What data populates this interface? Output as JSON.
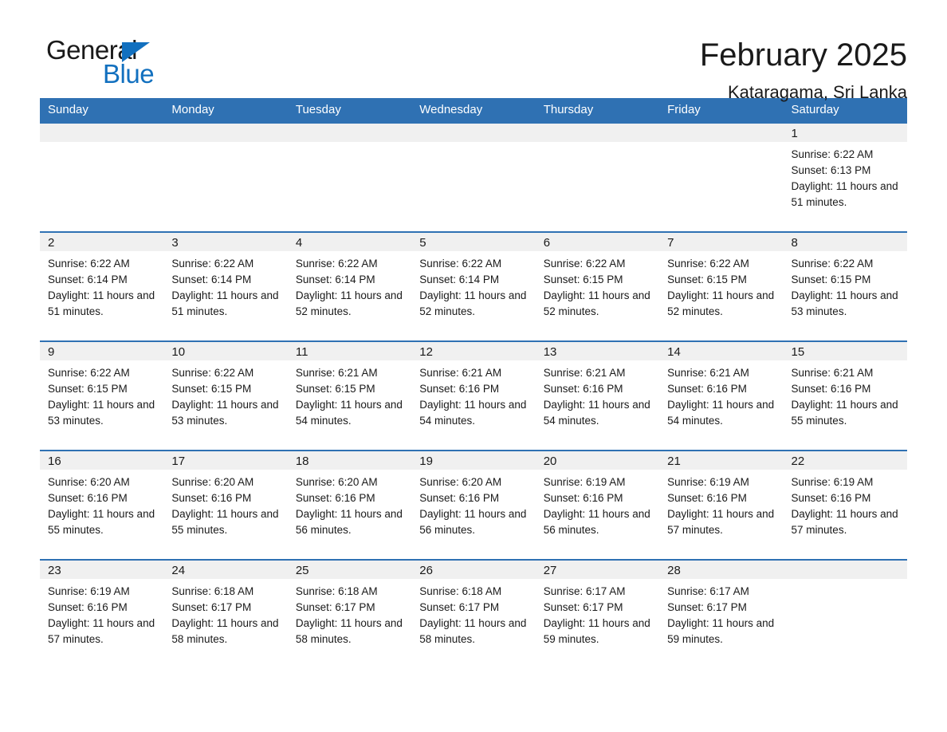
{
  "brand": {
    "name_part1": "General",
    "name_part2": "Blue",
    "triangle_color": "#1270bf"
  },
  "header": {
    "title": "February 2025",
    "subtitle": "Kataragama, Sri Lanka"
  },
  "theme": {
    "header_blue": "#2f71b3",
    "daynum_band": "#f0f0f0",
    "text": "#1a1a1a"
  },
  "calendar": {
    "weekdays": [
      "Sunday",
      "Monday",
      "Tuesday",
      "Wednesday",
      "Thursday",
      "Friday",
      "Saturday"
    ],
    "weeks": [
      [
        {
          "day": "",
          "sunrise": "",
          "sunset": "",
          "daylight": ""
        },
        {
          "day": "",
          "sunrise": "",
          "sunset": "",
          "daylight": ""
        },
        {
          "day": "",
          "sunrise": "",
          "sunset": "",
          "daylight": ""
        },
        {
          "day": "",
          "sunrise": "",
          "sunset": "",
          "daylight": ""
        },
        {
          "day": "",
          "sunrise": "",
          "sunset": "",
          "daylight": ""
        },
        {
          "day": "",
          "sunrise": "",
          "sunset": "",
          "daylight": ""
        },
        {
          "day": "1",
          "sunrise": "Sunrise: 6:22 AM",
          "sunset": "Sunset: 6:13 PM",
          "daylight": "Daylight: 11 hours and 51 minutes."
        }
      ],
      [
        {
          "day": "2",
          "sunrise": "Sunrise: 6:22 AM",
          "sunset": "Sunset: 6:14 PM",
          "daylight": "Daylight: 11 hours and 51 minutes."
        },
        {
          "day": "3",
          "sunrise": "Sunrise: 6:22 AM",
          "sunset": "Sunset: 6:14 PM",
          "daylight": "Daylight: 11 hours and 51 minutes."
        },
        {
          "day": "4",
          "sunrise": "Sunrise: 6:22 AM",
          "sunset": "Sunset: 6:14 PM",
          "daylight": "Daylight: 11 hours and 52 minutes."
        },
        {
          "day": "5",
          "sunrise": "Sunrise: 6:22 AM",
          "sunset": "Sunset: 6:14 PM",
          "daylight": "Daylight: 11 hours and 52 minutes."
        },
        {
          "day": "6",
          "sunrise": "Sunrise: 6:22 AM",
          "sunset": "Sunset: 6:15 PM",
          "daylight": "Daylight: 11 hours and 52 minutes."
        },
        {
          "day": "7",
          "sunrise": "Sunrise: 6:22 AM",
          "sunset": "Sunset: 6:15 PM",
          "daylight": "Daylight: 11 hours and 52 minutes."
        },
        {
          "day": "8",
          "sunrise": "Sunrise: 6:22 AM",
          "sunset": "Sunset: 6:15 PM",
          "daylight": "Daylight: 11 hours and 53 minutes."
        }
      ],
      [
        {
          "day": "9",
          "sunrise": "Sunrise: 6:22 AM",
          "sunset": "Sunset: 6:15 PM",
          "daylight": "Daylight: 11 hours and 53 minutes."
        },
        {
          "day": "10",
          "sunrise": "Sunrise: 6:22 AM",
          "sunset": "Sunset: 6:15 PM",
          "daylight": "Daylight: 11 hours and 53 minutes."
        },
        {
          "day": "11",
          "sunrise": "Sunrise: 6:21 AM",
          "sunset": "Sunset: 6:15 PM",
          "daylight": "Daylight: 11 hours and 54 minutes."
        },
        {
          "day": "12",
          "sunrise": "Sunrise: 6:21 AM",
          "sunset": "Sunset: 6:16 PM",
          "daylight": "Daylight: 11 hours and 54 minutes."
        },
        {
          "day": "13",
          "sunrise": "Sunrise: 6:21 AM",
          "sunset": "Sunset: 6:16 PM",
          "daylight": "Daylight: 11 hours and 54 minutes."
        },
        {
          "day": "14",
          "sunrise": "Sunrise: 6:21 AM",
          "sunset": "Sunset: 6:16 PM",
          "daylight": "Daylight: 11 hours and 54 minutes."
        },
        {
          "day": "15",
          "sunrise": "Sunrise: 6:21 AM",
          "sunset": "Sunset: 6:16 PM",
          "daylight": "Daylight: 11 hours and 55 minutes."
        }
      ],
      [
        {
          "day": "16",
          "sunrise": "Sunrise: 6:20 AM",
          "sunset": "Sunset: 6:16 PM",
          "daylight": "Daylight: 11 hours and 55 minutes."
        },
        {
          "day": "17",
          "sunrise": "Sunrise: 6:20 AM",
          "sunset": "Sunset: 6:16 PM",
          "daylight": "Daylight: 11 hours and 55 minutes."
        },
        {
          "day": "18",
          "sunrise": "Sunrise: 6:20 AM",
          "sunset": "Sunset: 6:16 PM",
          "daylight": "Daylight: 11 hours and 56 minutes."
        },
        {
          "day": "19",
          "sunrise": "Sunrise: 6:20 AM",
          "sunset": "Sunset: 6:16 PM",
          "daylight": "Daylight: 11 hours and 56 minutes."
        },
        {
          "day": "20",
          "sunrise": "Sunrise: 6:19 AM",
          "sunset": "Sunset: 6:16 PM",
          "daylight": "Daylight: 11 hours and 56 minutes."
        },
        {
          "day": "21",
          "sunrise": "Sunrise: 6:19 AM",
          "sunset": "Sunset: 6:16 PM",
          "daylight": "Daylight: 11 hours and 57 minutes."
        },
        {
          "day": "22",
          "sunrise": "Sunrise: 6:19 AM",
          "sunset": "Sunset: 6:16 PM",
          "daylight": "Daylight: 11 hours and 57 minutes."
        }
      ],
      [
        {
          "day": "23",
          "sunrise": "Sunrise: 6:19 AM",
          "sunset": "Sunset: 6:16 PM",
          "daylight": "Daylight: 11 hours and 57 minutes."
        },
        {
          "day": "24",
          "sunrise": "Sunrise: 6:18 AM",
          "sunset": "Sunset: 6:17 PM",
          "daylight": "Daylight: 11 hours and 58 minutes."
        },
        {
          "day": "25",
          "sunrise": "Sunrise: 6:18 AM",
          "sunset": "Sunset: 6:17 PM",
          "daylight": "Daylight: 11 hours and 58 minutes."
        },
        {
          "day": "26",
          "sunrise": "Sunrise: 6:18 AM",
          "sunset": "Sunset: 6:17 PM",
          "daylight": "Daylight: 11 hours and 58 minutes."
        },
        {
          "day": "27",
          "sunrise": "Sunrise: 6:17 AM",
          "sunset": "Sunset: 6:17 PM",
          "daylight": "Daylight: 11 hours and 59 minutes."
        },
        {
          "day": "28",
          "sunrise": "Sunrise: 6:17 AM",
          "sunset": "Sunset: 6:17 PM",
          "daylight": "Daylight: 11 hours and 59 minutes."
        },
        {
          "day": "",
          "sunrise": "",
          "sunset": "",
          "daylight": ""
        }
      ]
    ]
  }
}
